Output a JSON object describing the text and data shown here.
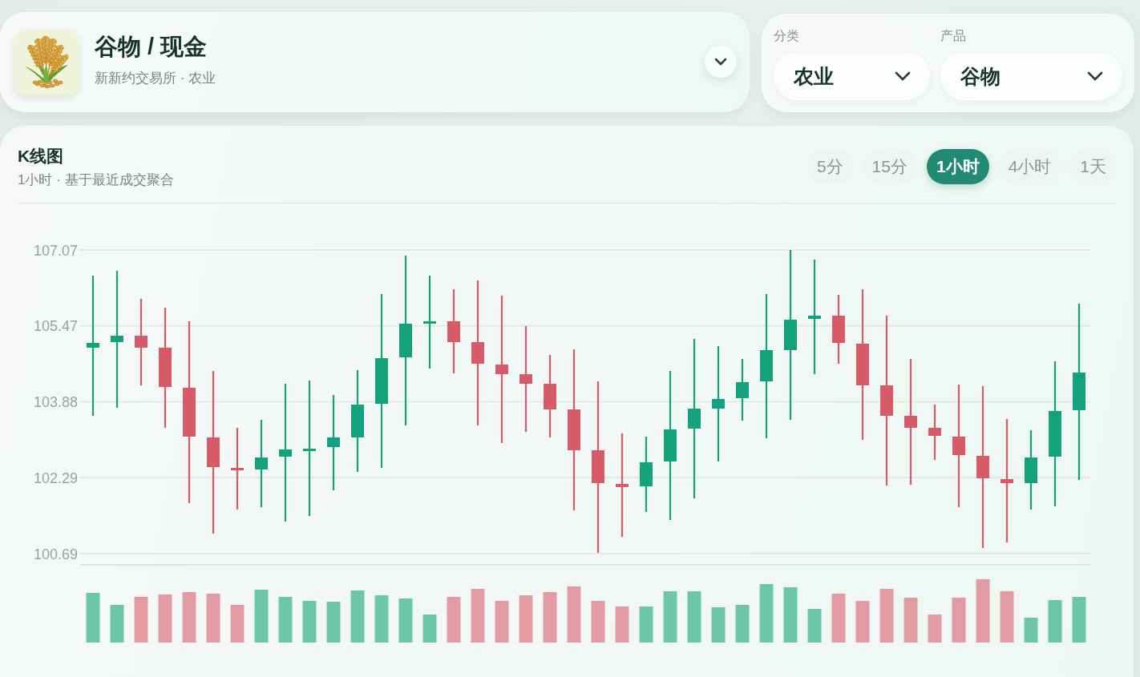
{
  "market_header": {
    "title": "谷物 / 现金",
    "subtitle": "新新约交易所 · 农业"
  },
  "filters": [
    {
      "label": "分类",
      "value": "农业"
    },
    {
      "label": "产品",
      "value": "谷物"
    }
  ],
  "chart_panel": {
    "title": "K线图",
    "subtitle": "1小时 · 基于最近成交聚合",
    "timeframes": [
      {
        "label": "5分",
        "selected": false
      },
      {
        "label": "15分",
        "selected": false
      },
      {
        "label": "1小时",
        "selected": true
      },
      {
        "label": "4小时",
        "selected": false
      },
      {
        "label": "1天",
        "selected": false
      }
    ],
    "y_axis_labels": [
      "107.07",
      "105.47",
      "103.88",
      "102.29",
      "100.69"
    ]
  }
}
